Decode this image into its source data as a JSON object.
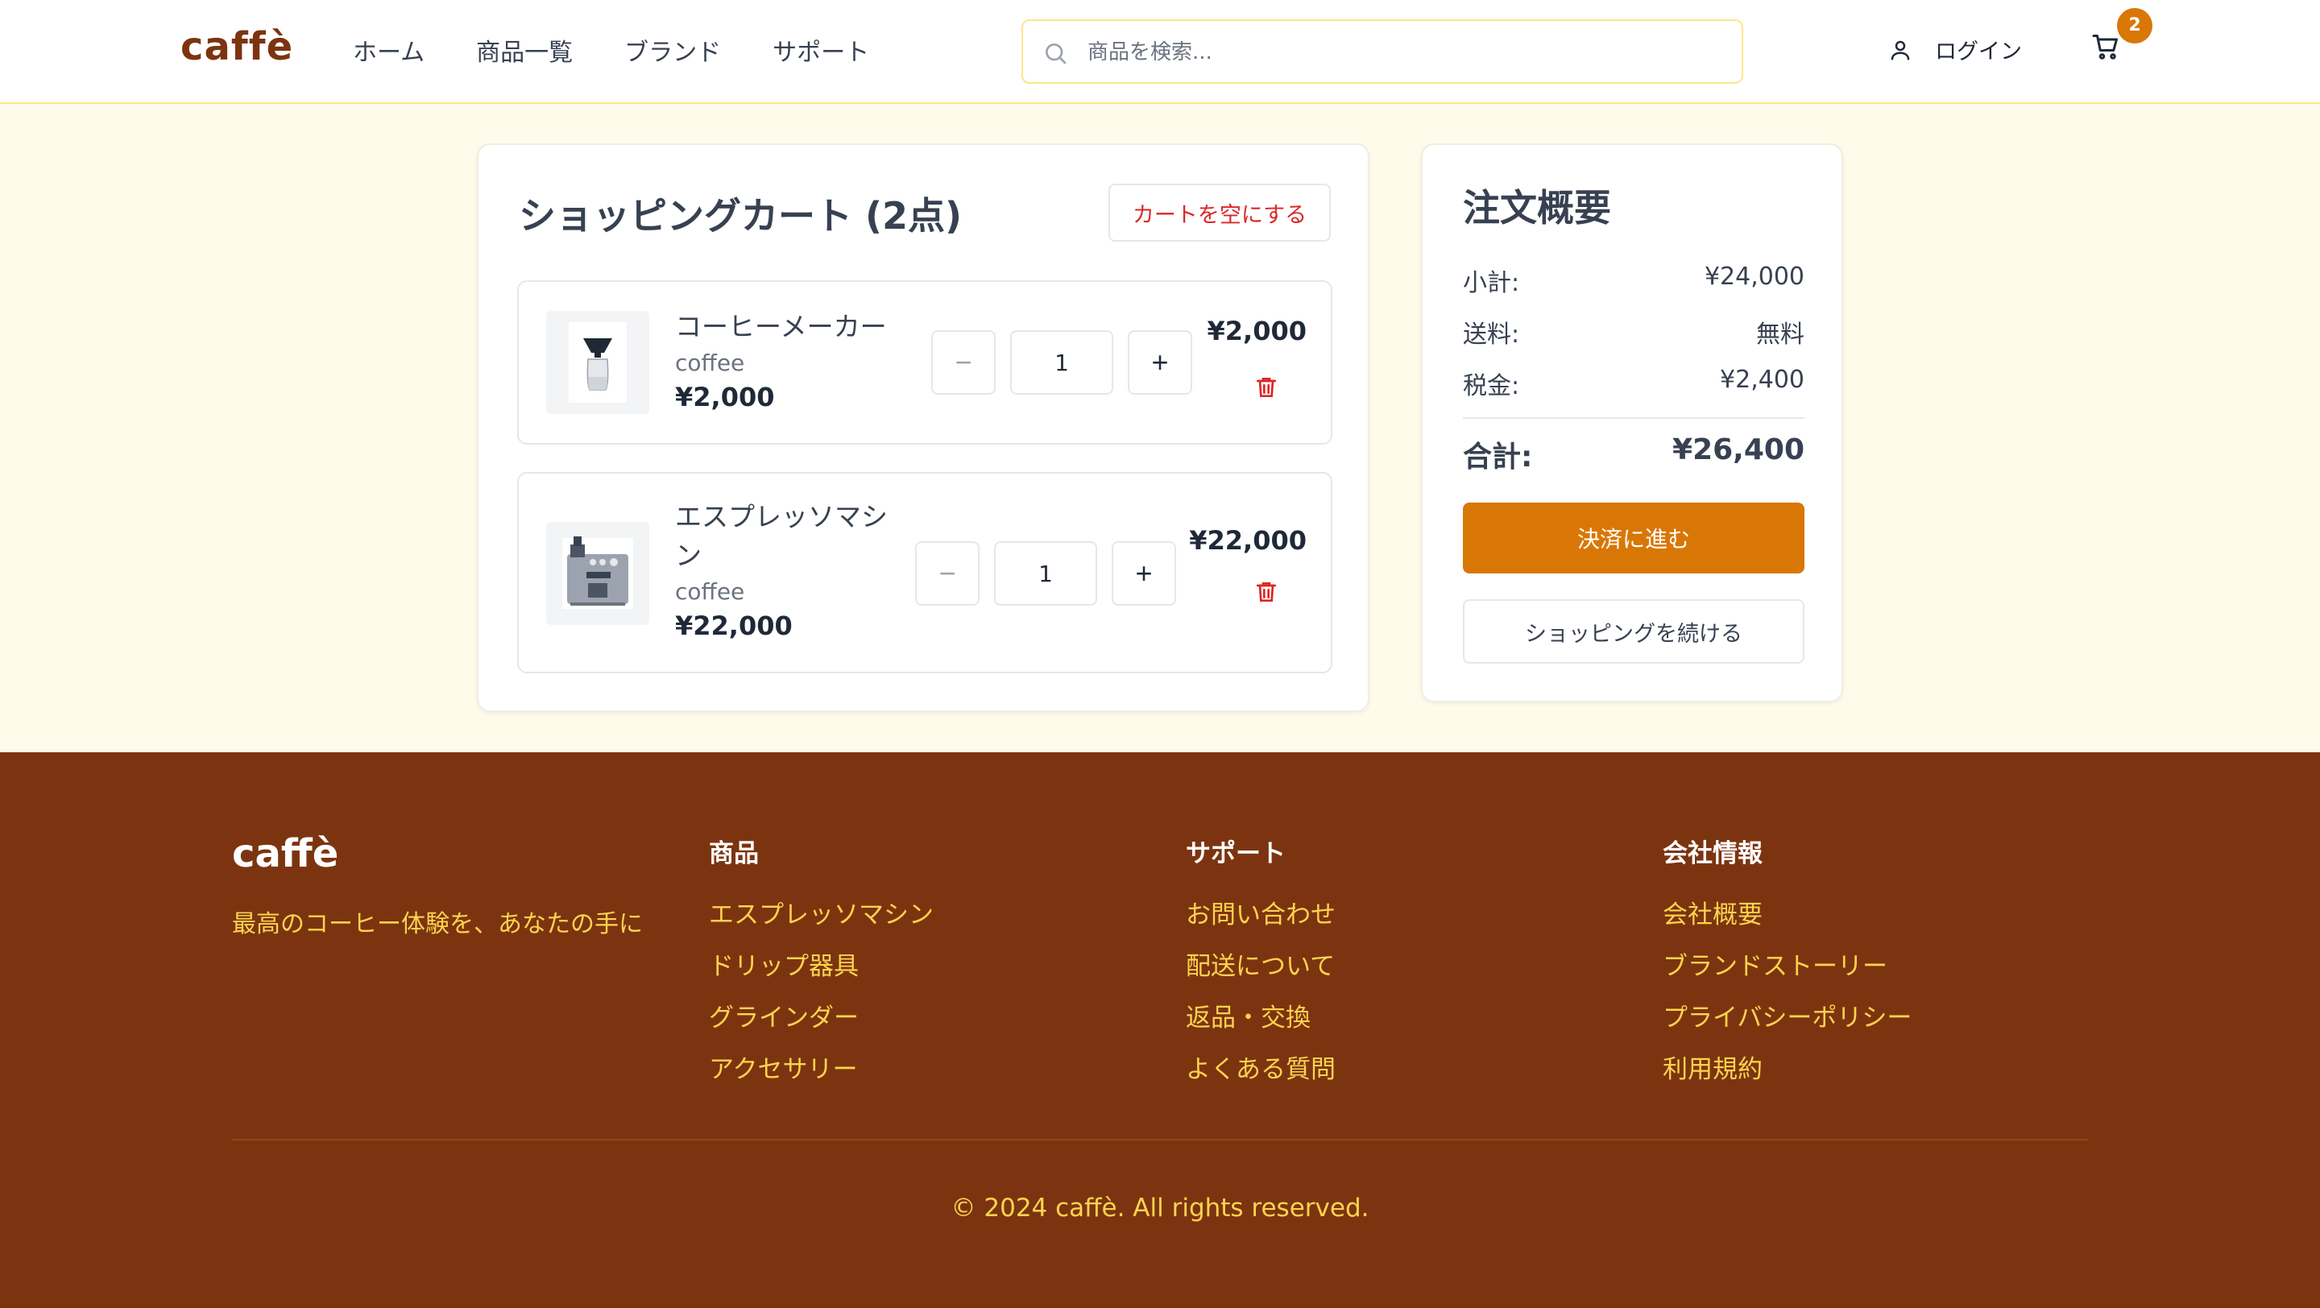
{
  "header": {
    "logo": "caffè",
    "nav": [
      "ホーム",
      "商品一覧",
      "ブランド",
      "サポート"
    ],
    "search_placeholder": "商品を検索...",
    "login_label": "ログイン",
    "cart_count": "2"
  },
  "cart": {
    "title": "ショッピングカート (2点)",
    "clear_label": "カートを空にする",
    "items": [
      {
        "name": "コーヒーメーカー",
        "brand": "coffee",
        "unit_price": "¥2,000",
        "quantity": "1",
        "line_total": "¥2,000",
        "image_icon": "pour-over-coffee-maker"
      },
      {
        "name": "エスプレッソマシン",
        "brand": "coffee",
        "unit_price": "¥22,000",
        "quantity": "1",
        "line_total": "¥22,000",
        "image_icon": "espresso-machine"
      }
    ]
  },
  "summary": {
    "title": "注文概要",
    "subtotal_label": "小計:",
    "subtotal_value": "¥24,000",
    "shipping_label": "送料:",
    "shipping_value": "無料",
    "tax_label": "税金:",
    "tax_value": "¥2,400",
    "total_label": "合計:",
    "total_value": "¥26,400",
    "checkout_label": "決済に進む",
    "continue_label": "ショッピングを続ける"
  },
  "footer": {
    "logo": "caffè",
    "tagline": "最高のコーヒー体験を、あなたの手に",
    "columns": [
      {
        "title": "商品",
        "links": [
          "エスプレッソマシン",
          "ドリップ器具",
          "グラインダー",
          "アクセサリー"
        ]
      },
      {
        "title": "サポート",
        "links": [
          "お問い合わせ",
          "配送について",
          "返品・交換",
          "よくある質問"
        ]
      },
      {
        "title": "会社情報",
        "links": [
          "会社概要",
          "ブランドストーリー",
          "プライバシーポリシー",
          "利用規約"
        ]
      }
    ],
    "copyright": "© 2024 caffè. All rights reserved."
  },
  "colors": {
    "brand_brown": "#7c3410",
    "accent_amber": "#d97706",
    "footer_link": "#fcd34d",
    "danger": "#dc2626"
  }
}
